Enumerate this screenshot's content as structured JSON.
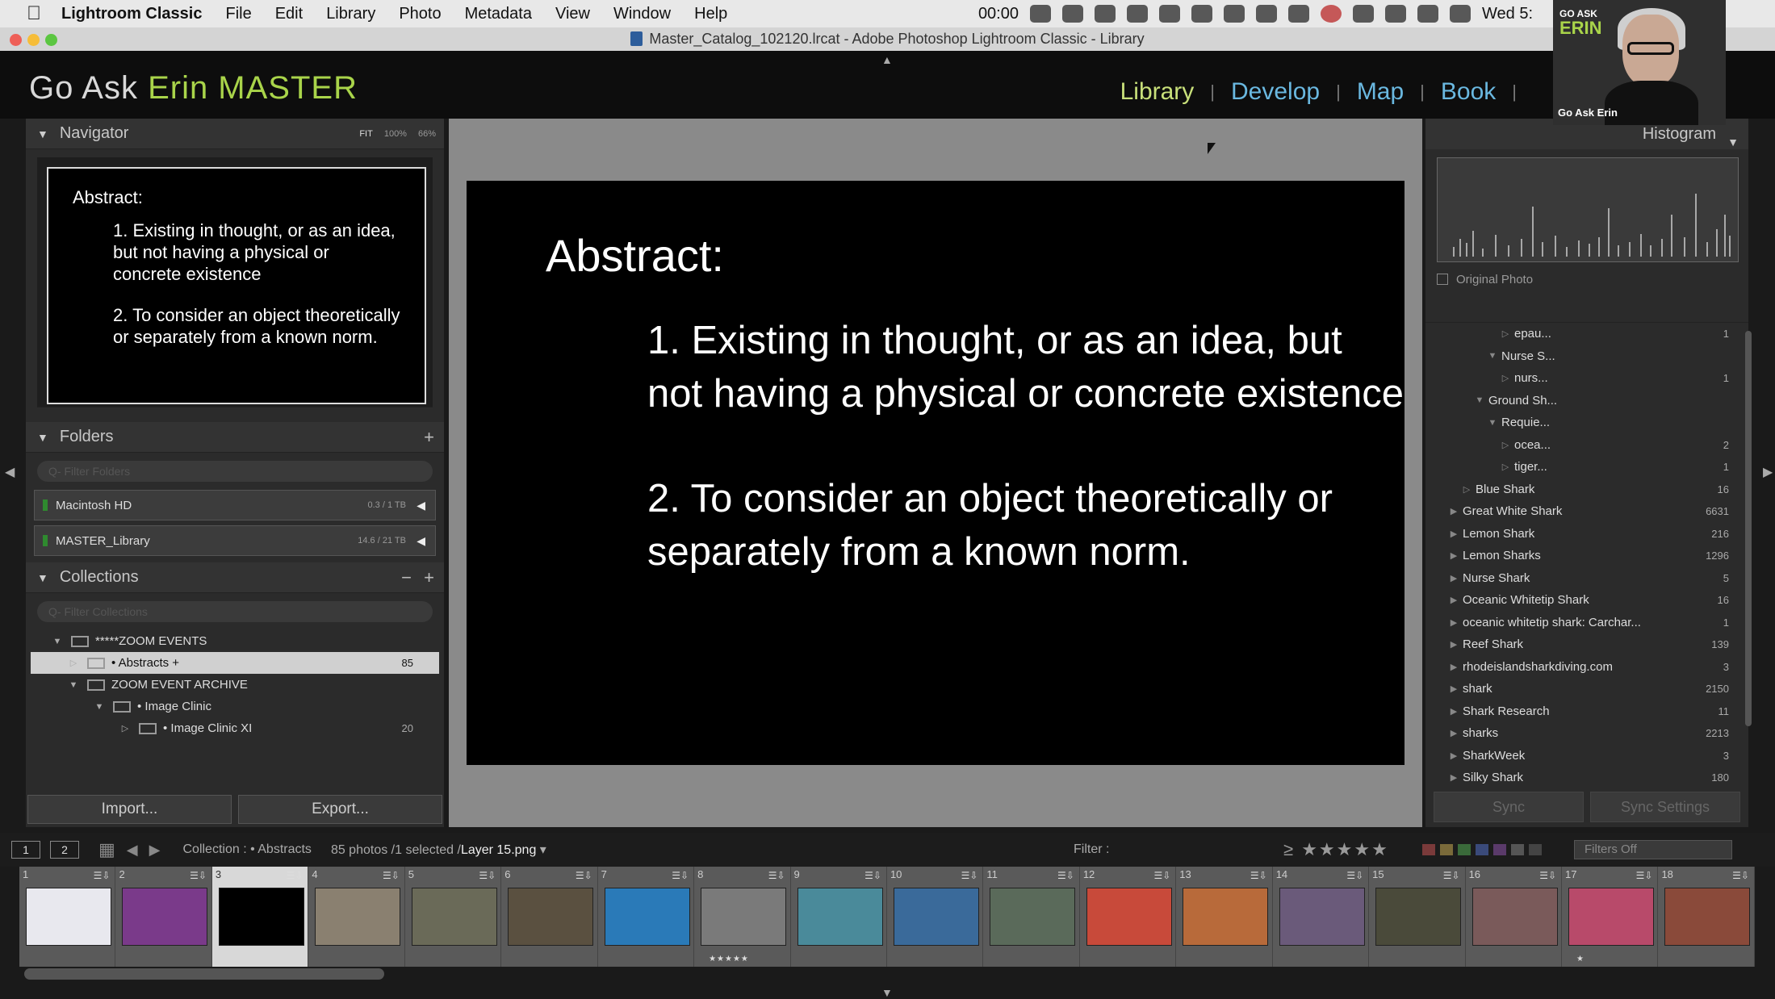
{
  "menubar": {
    "app_name": "Lightroom Classic",
    "items": [
      "File",
      "Edit",
      "Library",
      "Photo",
      "Metadata",
      "View",
      "Window",
      "Help"
    ],
    "time": "00:00",
    "date": "Wed 5:"
  },
  "window": {
    "title": "Master_Catalog_102120.lrcat - Adobe Photoshop Lightroom Classic - Library"
  },
  "identity": {
    "prefix": "Go Ask ",
    "accent": "Erin MASTER",
    "accent_color": "#a9d44a"
  },
  "modules": [
    {
      "label": "Library",
      "active": true
    },
    {
      "label": "Develop",
      "active": false
    },
    {
      "label": "Map",
      "active": false
    },
    {
      "label": "Book",
      "active": false
    }
  ],
  "navigator": {
    "title": "Navigator",
    "options": [
      "FIT",
      "100%",
      "66%"
    ],
    "preview": {
      "heading": "Abstract:",
      "point1": "1. Existing in thought, or as an idea, but not having a physical or concrete existence",
      "point2": "2. To consider an object theoretically or separately from a known norm."
    }
  },
  "folders": {
    "title": "Folders",
    "filter_placeholder": "Q- Filter Folders",
    "volumes": [
      {
        "name": "Macintosh HD",
        "size": "0.3 / 1 TB"
      },
      {
        "name": "MASTER_Library",
        "size": "14.6 / 21 TB"
      }
    ]
  },
  "collections": {
    "title": "Collections",
    "filter_placeholder": "Q- Filter Collections",
    "rows": [
      {
        "label": "*****ZOOM EVENTS",
        "count": "",
        "indent": 0
      },
      {
        "label": "• Abstracts  +",
        "count": "85",
        "indent": 1
      },
      {
        "label": "ZOOM EVENT ARCHIVE",
        "count": "",
        "indent": 1
      },
      {
        "label": "• Image Clinic",
        "count": "",
        "indent": 2
      },
      {
        "label": "• Image Clinic XI",
        "count": "20",
        "indent": 3
      }
    ]
  },
  "left_buttons": {
    "import": "Import...",
    "export": "Export..."
  },
  "slide": {
    "heading": "Abstract:",
    "point1": "1. Existing in thought, or as an idea, but not having a physical or concrete existence",
    "point2": "2. To consider an object theoretically or separately from a known norm."
  },
  "histogram": {
    "title": "Histogram",
    "original_photo": "Original Photo"
  },
  "keywords": [
    {
      "label": "epau...",
      "count": "1",
      "indent": 4,
      "tri": "▷"
    },
    {
      "label": "Nurse S...",
      "count": "",
      "indent": 3,
      "tri": "▼"
    },
    {
      "label": "nurs...",
      "count": "1",
      "indent": 4,
      "tri": "▷"
    },
    {
      "label": "Ground Sh...",
      "count": "",
      "indent": 2,
      "tri": "▼"
    },
    {
      "label": "Requie...",
      "count": "",
      "indent": 3,
      "tri": "▼"
    },
    {
      "label": "ocea...",
      "count": "2",
      "indent": 4,
      "tri": "▷"
    },
    {
      "label": "tiger...",
      "count": "1",
      "indent": 4,
      "tri": "▷"
    },
    {
      "label": "Blue Shark",
      "count": "16",
      "indent": 1,
      "tri": "▷"
    },
    {
      "label": "Great White Shark",
      "count": "6631",
      "indent": 0,
      "tri": "▶"
    },
    {
      "label": "Lemon Shark",
      "count": "216",
      "indent": 0,
      "tri": "▶"
    },
    {
      "label": "Lemon Sharks",
      "count": "1296",
      "indent": 0,
      "tri": "▶"
    },
    {
      "label": "Nurse Shark",
      "count": "5",
      "indent": 0,
      "tri": "▶"
    },
    {
      "label": "Oceanic Whitetip Shark",
      "count": "16",
      "indent": 0,
      "tri": "▶"
    },
    {
      "label": "oceanic whitetip shark: Carchar...",
      "count": "1",
      "indent": 0,
      "tri": "▶"
    },
    {
      "label": "Reef Shark",
      "count": "139",
      "indent": 0,
      "tri": "▶"
    },
    {
      "label": "rhodeislandsharkdiving.com",
      "count": "3",
      "indent": 0,
      "tri": "▶"
    },
    {
      "label": "shark",
      "count": "2150",
      "indent": 0,
      "tri": "▶"
    },
    {
      "label": "Shark Research",
      "count": "11",
      "indent": 0,
      "tri": "▶"
    },
    {
      "label": "sharks",
      "count": "2213",
      "indent": 0,
      "tri": "▶"
    },
    {
      "label": "SharkWeek",
      "count": "3",
      "indent": 0,
      "tri": "▶"
    },
    {
      "label": "Silky Shark",
      "count": "180",
      "indent": 0,
      "tri": "▶"
    }
  ],
  "sync": {
    "sync": "Sync",
    "sync_settings": "Sync Settings"
  },
  "webcam": {
    "logo_top": "GO ASK",
    "logo_main": "ERIN",
    "caption": "Go Ask Erin"
  },
  "filmstrip_toolbar": {
    "page1": "1",
    "page2": "2",
    "source": "Collection : • Abstracts",
    "count_text": "85 photos /1 selected /",
    "selected_file": "Layer 15.png",
    "filter_label": "Filter :",
    "rating_op": "≥",
    "filters_off": "Filters Off"
  },
  "filmstrip": [
    {
      "n": "1",
      "color": "#e8e8ee",
      "sel": false,
      "stars": ""
    },
    {
      "n": "2",
      "color": "#7a3a8a",
      "sel": false,
      "stars": ""
    },
    {
      "n": "3",
      "color": "#000000",
      "sel": true,
      "stars": ""
    },
    {
      "n": "4",
      "color": "#8a8070",
      "sel": false,
      "stars": ""
    },
    {
      "n": "5",
      "color": "#6a6a58",
      "sel": false,
      "stars": ""
    },
    {
      "n": "6",
      "color": "#5a5040",
      "sel": false,
      "stars": ""
    },
    {
      "n": "7",
      "color": "#2a7ab8",
      "sel": false,
      "stars": ""
    },
    {
      "n": "8",
      "color": "#7a7a7a",
      "sel": false,
      "stars": "★★★★★"
    },
    {
      "n": "9",
      "color": "#4a8a9a",
      "sel": false,
      "stars": ""
    },
    {
      "n": "10",
      "color": "#3a6a9a",
      "sel": false,
      "stars": ""
    },
    {
      "n": "11",
      "color": "#5a6a5a",
      "sel": false,
      "stars": ""
    },
    {
      "n": "12",
      "color": "#c84a3a",
      "sel": false,
      "stars": ""
    },
    {
      "n": "13",
      "color": "#b86a3a",
      "sel": false,
      "stars": ""
    },
    {
      "n": "14",
      "color": "#6a5a7a",
      "sel": false,
      "stars": ""
    },
    {
      "n": "15",
      "color": "#4a4a3a",
      "sel": false,
      "stars": ""
    },
    {
      "n": "16",
      "color": "#7a5a5a",
      "sel": false,
      "stars": ""
    },
    {
      "n": "17",
      "color": "#b84a6a",
      "sel": false,
      "stars": "★"
    },
    {
      "n": "18",
      "color": "#8a4a3a",
      "sel": false,
      "stars": ""
    }
  ]
}
